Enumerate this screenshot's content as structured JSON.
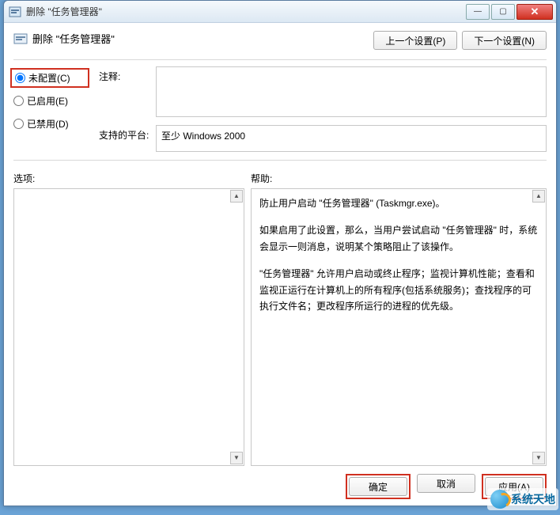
{
  "window": {
    "title": "删除 \"任务管理器\""
  },
  "header": {
    "title": "删除 \"任务管理器\"",
    "prev_btn": "上一个设置(P)",
    "next_btn": "下一个设置(N)"
  },
  "radios": {
    "not_configured": "未配置(C)",
    "enabled": "已启用(E)",
    "disabled": "已禁用(D)",
    "selected": "not_configured"
  },
  "fields": {
    "comment_label": "注释:",
    "comment_value": "",
    "platform_label": "支持的平台:",
    "platform_value": "至少 Windows 2000"
  },
  "sections": {
    "options_label": "选项:",
    "help_label": "帮助:"
  },
  "help_text": {
    "p1": "防止用户启动 \"任务管理器\" (Taskmgr.exe)。",
    "p2": "如果启用了此设置，那么，当用户尝试启动 \"任务管理器\" 时，系统会显示一则消息，说明某个策略阻止了该操作。",
    "p3": "\"任务管理器\" 允许用户启动或终止程序；监视计算机性能；查看和监视正运行在计算机上的所有程序(包括系统服务)；查找程序的可执行文件名；更改程序所运行的进程的优先级。"
  },
  "footer": {
    "ok": "确定",
    "cancel": "取消",
    "apply": "应用(A)"
  },
  "watermark": "系统天地"
}
